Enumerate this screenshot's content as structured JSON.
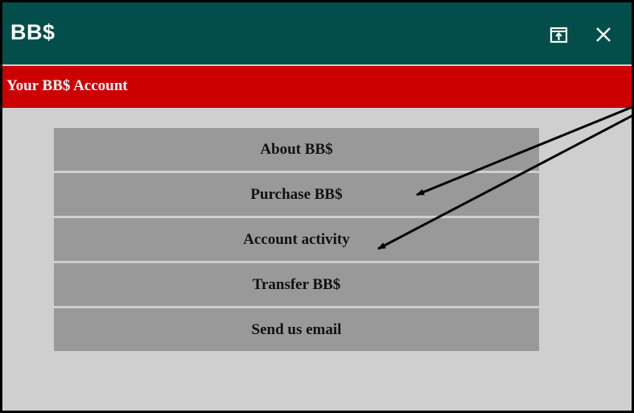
{
  "window": {
    "app_title": "BB$",
    "buttons": {
      "popout_icon": "popout-icon",
      "close_icon": "close-icon"
    }
  },
  "account_header": {
    "title": "Your BB$ Account"
  },
  "menu": {
    "items": [
      {
        "label": "About BB$"
      },
      {
        "label": "Purchase BB$"
      },
      {
        "label": "Account activity"
      },
      {
        "label": "Transfer BB$"
      },
      {
        "label": "Send us email"
      }
    ]
  },
  "colors": {
    "titlebar": "#034e4a",
    "account_header": "#cc0000",
    "body_background": "#cfcfcf",
    "menu_item": "#999999",
    "annotation_arrow": "#000000"
  }
}
